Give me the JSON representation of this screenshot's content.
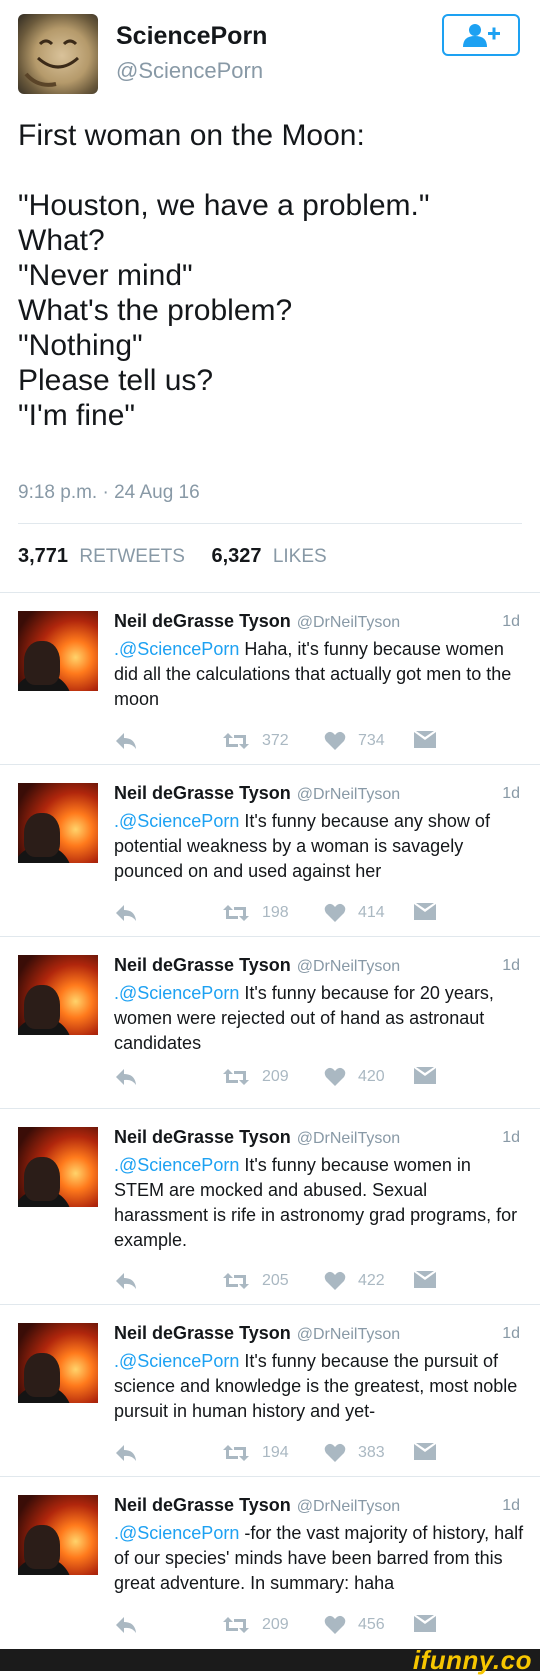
{
  "main_tweet": {
    "name": "SciencePorn",
    "handle": "@SciencePorn",
    "text": "First woman on the Moon:\n\n\"Houston, we have a problem.\"\nWhat?\n\"Never mind\"\nWhat's the problem?\n\"Nothing\"\nPlease tell us?\n\"I'm fine\"",
    "timestamp": "9:18 p.m. · 24 Aug 16",
    "retweets_count": "3,771",
    "retweets_label": "RETWEETS",
    "likes_count": "6,327",
    "likes_label": "LIKES"
  },
  "replies": [
    {
      "name": "Neil deGrasse Tyson",
      "handle": "@DrNeilTyson",
      "age": "1d",
      "mention": ".@SciencePorn",
      "text": "Haha, it's funny because women did all the calculations that actually got men to the moon",
      "retweets": "372",
      "likes": "734"
    },
    {
      "name": "Neil deGrasse Tyson",
      "handle": "@DrNeilTyson",
      "age": "1d",
      "mention": ".@SciencePorn",
      "text": "It's funny because any show of potential weakness by a woman is savagely pounced on and used against her",
      "retweets": "198",
      "likes": "414"
    },
    {
      "name": "Neil deGrasse Tyson",
      "handle": "@DrNeilTyson",
      "age": "1d",
      "mention": ".@SciencePorn",
      "text": "It's funny because for 20 years, women were rejected out of hand as astronaut candidates",
      "retweets": "209",
      "likes": "420"
    },
    {
      "name": "Neil deGrasse Tyson",
      "handle": "@DrNeilTyson",
      "age": "1d",
      "mention": ".@SciencePorn",
      "text": "It's funny because women in STEM are mocked and abused. Sexual harassment is rife in astronomy grad programs, for example.",
      "retweets": "205",
      "likes": "422"
    },
    {
      "name": "Neil deGrasse Tyson",
      "handle": "@DrNeilTyson",
      "age": "1d",
      "mention": ".@SciencePorn",
      "text": "It's funny because the pursuit of science and knowledge is the greatest, most noble pursuit in human history and yet-",
      "retweets": "194",
      "likes": "383"
    },
    {
      "name": "Neil deGrasse Tyson",
      "handle": "@DrNeilTyson",
      "age": "1d",
      "mention": ".@SciencePorn",
      "text": "-for the vast majority of history, half of our species' minds have been barred from this great adventure. In summary: haha",
      "retweets": "209",
      "likes": "456"
    }
  ],
  "icons": {
    "follow": "add-user-icon",
    "reply": "reply-icon",
    "retweet": "retweet-icon",
    "like": "heart-icon",
    "dm": "envelope-icon"
  },
  "watermark": "ifunny.co",
  "colors": {
    "accent": "#1da1f2",
    "muted": "#8899a6",
    "icon": "#aab8c2",
    "text": "#14171a",
    "divider": "#e1e8ed"
  }
}
